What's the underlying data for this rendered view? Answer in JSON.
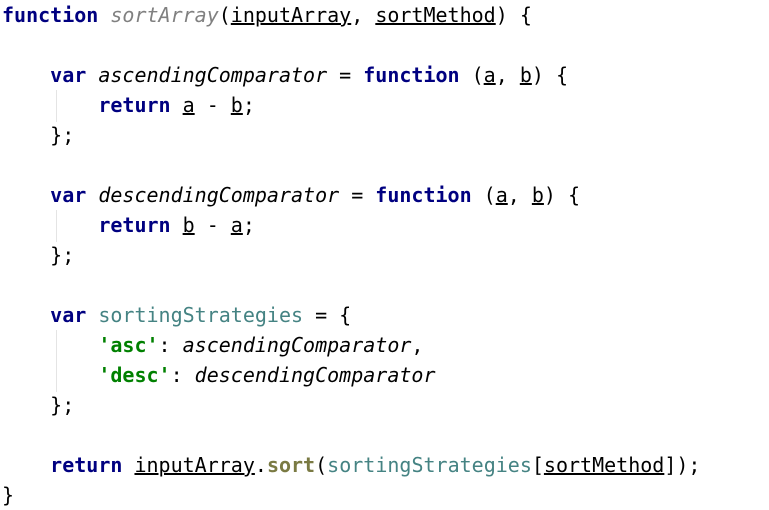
{
  "code": {
    "l1": {
      "kw": "function",
      "name": "sortArray",
      "open": "(",
      "p1": "inputArray",
      "sep": ", ",
      "p2": "sortMethod",
      "close": ") {"
    },
    "l3": {
      "kw_var": "var",
      "name": "ascendingComparator",
      "eq": " = ",
      "kw_fn": "function",
      "open": " (",
      "a": "a",
      "sep": ", ",
      "b": "b",
      "close": ") {"
    },
    "l4": {
      "kw": "return",
      "lhs": "a",
      "op": " - ",
      "rhs": "b",
      "end": ";"
    },
    "l5": {
      "text": "};"
    },
    "l7": {
      "kw_var": "var",
      "name": "descendingComparator",
      "eq": " = ",
      "kw_fn": "function",
      "open": " (",
      "a": "a",
      "sep": ", ",
      "b": "b",
      "close": ") {"
    },
    "l8": {
      "kw": "return",
      "lhs": "b",
      "op": " - ",
      "rhs": "a",
      "end": ";"
    },
    "l9": {
      "text": "};"
    },
    "l11": {
      "kw_var": "var",
      "name": "sortingStrategies",
      "rest": " = {"
    },
    "l12": {
      "key": "'asc'",
      "colon": ": ",
      "value": "ascendingComparator",
      "end": ","
    },
    "l13": {
      "key": "'desc'",
      "colon": ": ",
      "value": "descendingComparator"
    },
    "l14": {
      "text": "};"
    },
    "l16": {
      "kw": "return",
      "target": "inputArray",
      "dot": ".",
      "method": "sort",
      "open": "(",
      "obj": "sortingStrategies",
      "bracket_open": "[",
      "key": "sortMethod",
      "close": "]);"
    },
    "l17": {
      "text": "}"
    }
  }
}
